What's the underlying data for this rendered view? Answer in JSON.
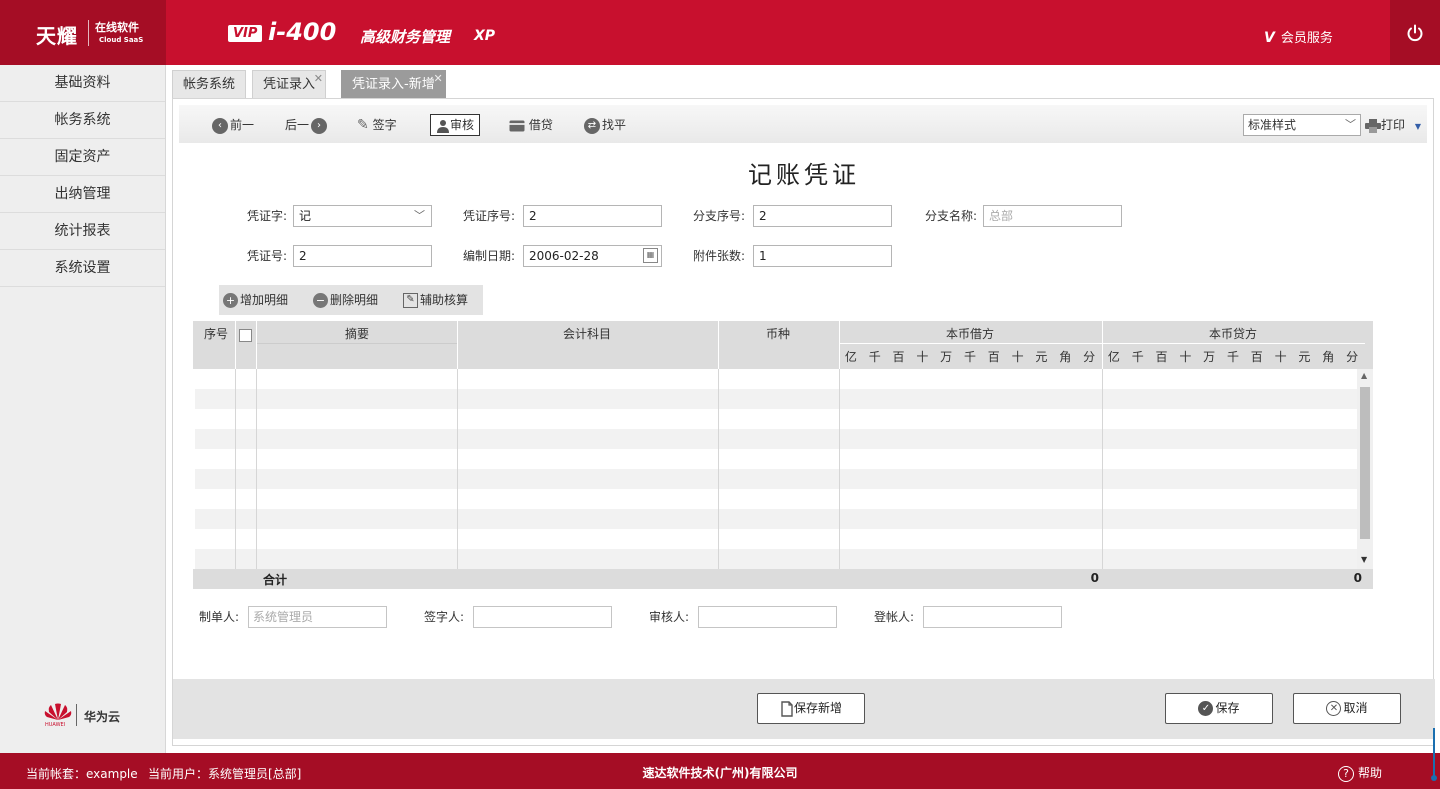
{
  "header": {
    "brand": "天耀",
    "brand_sub": "在线软件",
    "brand_sub2": "Cloud SaaS",
    "vip": "VIP",
    "product_code": "i-400",
    "product_name": "高级财务管理",
    "edition": "XP",
    "member_v": "V",
    "member_service": "会员服务",
    "power_icon": "power-icon"
  },
  "sidebar": {
    "items": [
      {
        "label": "基础资料"
      },
      {
        "label": "帐务系统"
      },
      {
        "label": "固定资产"
      },
      {
        "label": "出纳管理"
      },
      {
        "label": "统计报表"
      },
      {
        "label": "系统设置"
      }
    ],
    "partner": "华为云",
    "partner_small": "HUAWEI"
  },
  "tabs": [
    {
      "label": "帐务系统",
      "closable": false
    },
    {
      "label": "凭证录入",
      "closable": true
    },
    {
      "label": "凭证录入-新增",
      "closable": true,
      "active": true
    }
  ],
  "toolbar": {
    "prev": "前一",
    "next": "后一",
    "sign": "签字",
    "audit": "审核",
    "debit_credit": "借贷",
    "balance": "找平",
    "style_select": "标准样式",
    "print": "打印"
  },
  "voucher": {
    "title": "记账凭证",
    "fields": {
      "voucher_word_label": "凭证字:",
      "voucher_word": "记",
      "voucher_seq_label": "凭证序号:",
      "voucher_seq": "2",
      "branch_seq_label": "分支序号:",
      "branch_seq": "2",
      "branch_name_label": "分支名称:",
      "branch_name_placeholder": "总部",
      "voucher_no_label": "凭证号:",
      "voucher_no": "2",
      "date_label": "编制日期:",
      "date": "2006-02-28",
      "attachments_label": "附件张数:",
      "attachments": "1"
    }
  },
  "detail_toolbar": {
    "add": "增加明细",
    "delete": "删除明细",
    "assist": "辅助核算"
  },
  "grid": {
    "columns": {
      "seq": "序号",
      "summary": "摘要",
      "account": "会计科目",
      "currency": "币种",
      "debit": "本币借方",
      "credit": "本币贷方"
    },
    "digits": [
      "亿",
      "千",
      "百",
      "十",
      "万",
      "千",
      "百",
      "十",
      "元",
      "角",
      "分"
    ],
    "total_label": "合计",
    "debit_total": "0",
    "credit_total": "0",
    "empty_rows": 10
  },
  "signatures": {
    "maker_label": "制单人:",
    "maker_placeholder": "系统管理员",
    "signer_label": "签字人:",
    "auditor_label": "审核人:",
    "poster_label": "登帐人:"
  },
  "actions": {
    "save_new": "保存新增",
    "save": "保存",
    "cancel": "取消"
  },
  "footer": {
    "account": "当前帐套：example",
    "user": "当前用户：系统管理员[总部]",
    "company": "速达软件技术(广州)有限公司",
    "help": "帮助"
  },
  "colors": {
    "brand_red": "#c8102e",
    "brand_dark_red": "#a50d25"
  }
}
